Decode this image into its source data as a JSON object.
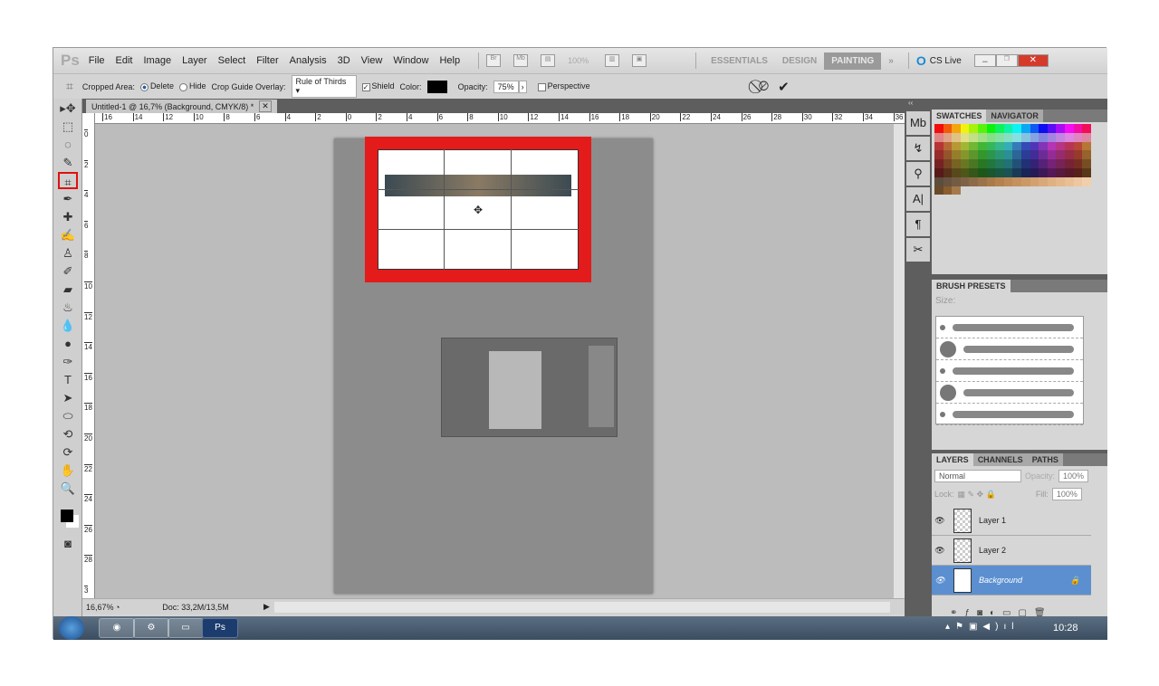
{
  "menubar": {
    "logo": "Ps",
    "items": [
      "File",
      "Edit",
      "Image",
      "Layer",
      "Select",
      "Filter",
      "Analysis",
      "3D",
      "View",
      "Window",
      "Help"
    ],
    "br": "Br",
    "mb": "Mb",
    "zoom": "100%",
    "workspaces": [
      "ESSENTIALS",
      "DESIGN",
      "PAINTING"
    ],
    "active_workspace": "PAINTING",
    "more": "»",
    "cslive": "CS Live"
  },
  "options": {
    "cropped_area_label": "Cropped Area:",
    "delete_label": "Delete",
    "hide_label": "Hide",
    "selected": "Delete",
    "overlay_label": "Crop Guide Overlay:",
    "overlay_value": "Rule of Thirds",
    "shield_label": "Shield",
    "shield_checked": true,
    "color_label": "Color:",
    "shield_color": "#000000",
    "opacity_label": "Opacity:",
    "opacity_value": "75%",
    "perspective_label": "Perspective",
    "perspective_checked": false
  },
  "document": {
    "tab_title": "Untitled-1 @ 16,7% (Background, CMYK/8) *",
    "hruler": [
      "16",
      "14",
      "12",
      "10",
      "8",
      "6",
      "4",
      "2",
      "0",
      "2",
      "4",
      "6",
      "8",
      "10",
      "12",
      "14",
      "16",
      "18",
      "20",
      "22",
      "24",
      "26",
      "28",
      "30",
      "32",
      "34",
      "36"
    ],
    "vruler": [
      "0",
      "2",
      "4",
      "6",
      "8",
      "10",
      "12",
      "14",
      "16",
      "18",
      "20",
      "22",
      "24",
      "26",
      "28",
      "3"
    ]
  },
  "status": {
    "zoom": "16,67%",
    "doc": "Doc: 33,2M/13,5M"
  },
  "swatches": {
    "tabs": [
      "SWATCHES",
      "NAVIGATOR"
    ]
  },
  "brush_presets": {
    "title": "BRUSH PRESETS",
    "size_label": "Size:"
  },
  "layers": {
    "tabs": [
      "LAYERS",
      "CHANNELS",
      "PATHS"
    ],
    "blend_mode": "Normal",
    "opacity_label": "Opacity:",
    "opacity": "100%",
    "lock_label": "Lock:",
    "fill_label": "Fill:",
    "fill": "100%",
    "items": [
      {
        "name": "Layer 1",
        "selected": false
      },
      {
        "name": "Layer 2",
        "selected": false
      },
      {
        "name": "Background",
        "selected": true
      }
    ]
  },
  "taskbar": {
    "clock": "10:28",
    "apps": [
      "chrome",
      "network",
      "explorer",
      "Ps"
    ]
  },
  "colors": {
    "crop_highlight": "#e41b1b",
    "selected_layer": "#5b8fd0",
    "canvas_bg": "#bcbcbc",
    "document": "#8c8c8c"
  }
}
